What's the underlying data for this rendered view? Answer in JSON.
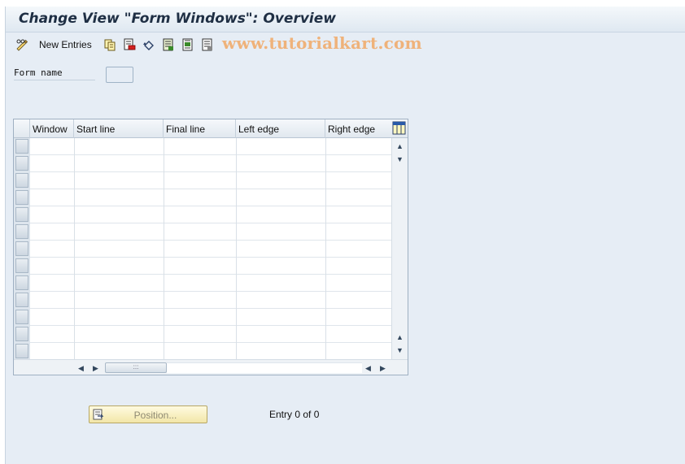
{
  "header": {
    "title": "Change View \"Form Windows\": Overview"
  },
  "toolbar": {
    "new_entries_label": "New Entries",
    "icons": [
      "display-change-icon",
      "copy-icon",
      "delete-icon",
      "undo-icon",
      "select-all-icon",
      "select-block-icon",
      "deselect-all-icon"
    ]
  },
  "watermark": "www.tutorialkart.com",
  "filter": {
    "form_name_label": "Form name",
    "form_name_value": ""
  },
  "table": {
    "columns": [
      "Window",
      "Start line",
      "Final line",
      "Left edge",
      "Right edge"
    ],
    "rows": [],
    "visible_empty_rows": 13
  },
  "footer": {
    "position_button_label": "Position...",
    "entry_text": "Entry 0 of 0"
  },
  "colors": {
    "background": "#e6edf5",
    "title_text": "#1f2f44",
    "watermark": "#efb27a",
    "position_button": "#f2e6a8"
  }
}
